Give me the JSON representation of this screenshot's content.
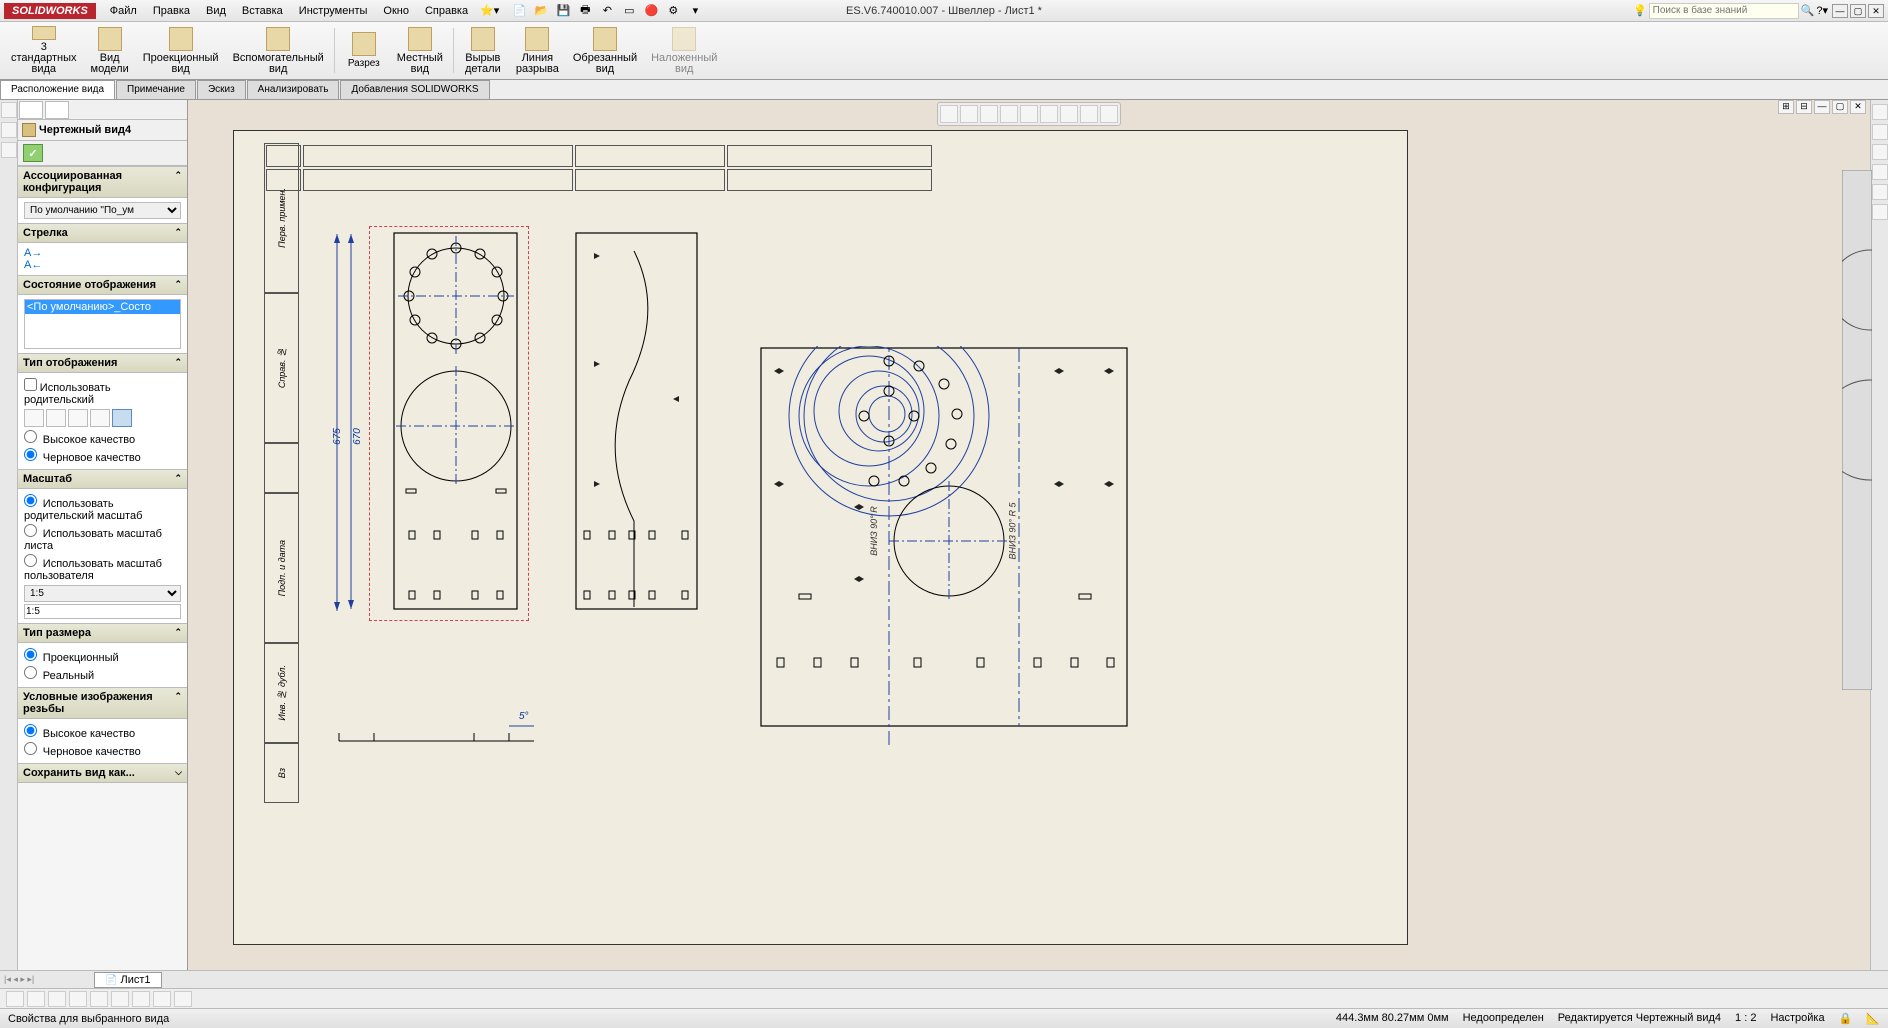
{
  "app": {
    "name": "SOLIDWORKS",
    "title": "ES.V6.740010.007 - Швеллер - Лист1 *"
  },
  "menu": [
    "Файл",
    "Правка",
    "Вид",
    "Вставка",
    "Инструменты",
    "Окно",
    "Справка"
  ],
  "search": {
    "placeholder": "Поиск в базе знаний"
  },
  "ribbon": {
    "items": [
      {
        "l1": "3",
        "l2": "стандартных",
        "l3": "вида"
      },
      {
        "l1": "Вид",
        "l2": "модели"
      },
      {
        "l1": "Проекционный",
        "l2": "вид"
      },
      {
        "l1": "Вспомогательный",
        "l2": "вид"
      },
      {
        "l1": "Разрез"
      },
      {
        "l1": "Местный",
        "l2": "вид"
      },
      {
        "l1": "Вырыв",
        "l2": "детали"
      },
      {
        "l1": "Линия",
        "l2": "разрыва"
      },
      {
        "l1": "Обрезанный",
        "l2": "вид"
      },
      {
        "l1": "Наложенный",
        "l2": "вид"
      }
    ]
  },
  "cmdtabs": [
    "Расположение вида",
    "Примечание",
    "Эскиз",
    "Анализировать",
    "Добавления SOLIDWORKS"
  ],
  "pm": {
    "title": "Чертежный вид4",
    "sections": {
      "assoc": {
        "h": "Ассоциированная конфигурация",
        "val": "По умолчанию \"По_ум"
      },
      "arrow": {
        "h": "Стрелка",
        "a": "A→",
        "b": "A←"
      },
      "disp": {
        "h": "Состояние отображения",
        "val": "<По умолчанию>_Состо"
      },
      "dtype": {
        "h": "Тип отображения",
        "chk": "Использовать родительский",
        "r1": "Высокое качество",
        "r2": "Черновое качество"
      },
      "scale": {
        "h": "Масштаб",
        "r1": "Использовать родительский масштаб",
        "r2": "Использовать масштаб листа",
        "r3": "Использовать масштаб пользователя",
        "v1": "1:5",
        "v2": "1:5"
      },
      "dimtype": {
        "h": "Тип размера",
        "r1": "Проекционный",
        "r2": "Реальный"
      },
      "thread": {
        "h": "Условные изображения резьбы",
        "r1": "Высокое качество",
        "r2": "Черновое качество"
      },
      "save": {
        "h": "Сохранить вид как..."
      }
    }
  },
  "drawing": {
    "dims": {
      "d1": "675",
      "d2": "670",
      "d3": "5°"
    },
    "annot": {
      "a1": "ВНИЗ 90° R",
      "a2": "ВНИЗ 90° R 5"
    },
    "sidelabels": [
      "Перв. примен.",
      "Справ. №",
      "Подп. и дата",
      "Инв. № дубл.",
      "Вз"
    ]
  },
  "sheettab": "Лист1",
  "status": {
    "left": "Свойства для выбранного вида",
    "coord": "444.3мм   80.27мм   0мм",
    "def": "Недоопределен",
    "edit": "Редактируется Чертежный вид4",
    "scale": "1 : 2",
    "mode": "Настройка"
  }
}
